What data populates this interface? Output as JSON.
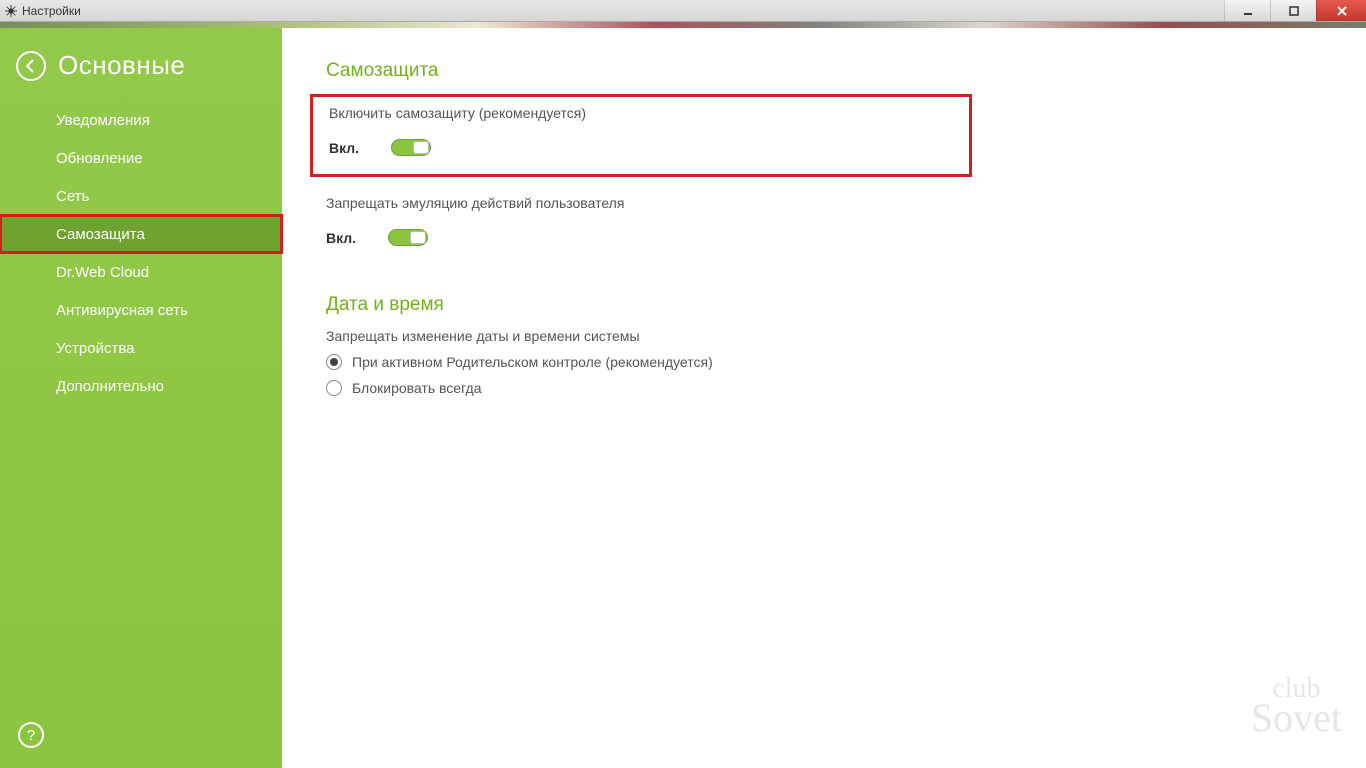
{
  "window": {
    "title": "Настройки"
  },
  "sidebar": {
    "title": "Основные",
    "items": [
      {
        "label": "Уведомления"
      },
      {
        "label": "Обновление"
      },
      {
        "label": "Сеть"
      },
      {
        "label": "Самозащита"
      },
      {
        "label": "Dr.Web Cloud"
      },
      {
        "label": "Антивирусная сеть"
      },
      {
        "label": "Устройства"
      },
      {
        "label": "Дополнительно"
      }
    ],
    "help": "?"
  },
  "sections": {
    "self_protection": {
      "title": "Самозащита",
      "opt1_label": "Включить самозащиту (рекомендуется)",
      "opt1_state": "Вкл.",
      "opt2_label": "Запрещать эмуляцию действий пользователя",
      "opt2_state": "Вкл."
    },
    "datetime": {
      "title": "Дата и время",
      "desc": "Запрещать изменение даты и времени системы",
      "radio1": "При активном Родительском контроле (рекомендуется)",
      "radio2": "Блокировать всегда"
    }
  },
  "watermark": {
    "line1": "club",
    "line2": "Sovet"
  }
}
